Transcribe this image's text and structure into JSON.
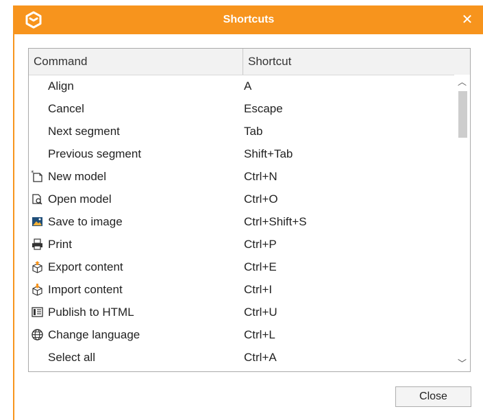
{
  "dialog": {
    "title": "Shortcuts",
    "close_glyph": "✕",
    "accent_color": "#f7941d"
  },
  "table": {
    "headers": {
      "command": "Command",
      "shortcut": "Shortcut"
    },
    "rows": [
      {
        "command": "Align",
        "shortcut": "A",
        "icon": ""
      },
      {
        "command": "Cancel",
        "shortcut": "Escape",
        "icon": ""
      },
      {
        "command": "Next segment",
        "shortcut": "Tab",
        "icon": ""
      },
      {
        "command": "Previous segment",
        "shortcut": "Shift+Tab",
        "icon": ""
      },
      {
        "command": "New model",
        "shortcut": "Ctrl+N",
        "icon": "new-document-icon"
      },
      {
        "command": "Open model",
        "shortcut": "Ctrl+O",
        "icon": "open-document-icon"
      },
      {
        "command": "Save to image",
        "shortcut": "Ctrl+Shift+S",
        "icon": "image-icon"
      },
      {
        "command": "Print",
        "shortcut": "Ctrl+P",
        "icon": "printer-icon"
      },
      {
        "command": "Export content",
        "shortcut": "Ctrl+E",
        "icon": "export-box-icon"
      },
      {
        "command": "Import content",
        "shortcut": "Ctrl+I",
        "icon": "import-box-icon"
      },
      {
        "command": "Publish to HTML",
        "shortcut": "Ctrl+U",
        "icon": "publish-html-icon"
      },
      {
        "command": "Change language",
        "shortcut": "Ctrl+L",
        "icon": "globe-icon"
      },
      {
        "command": "Select all",
        "shortcut": "Ctrl+A",
        "icon": ""
      }
    ]
  },
  "scrollbar": {
    "up_glyph": "︿",
    "down_glyph": "﹀"
  },
  "buttons": {
    "close_label": "Close"
  }
}
